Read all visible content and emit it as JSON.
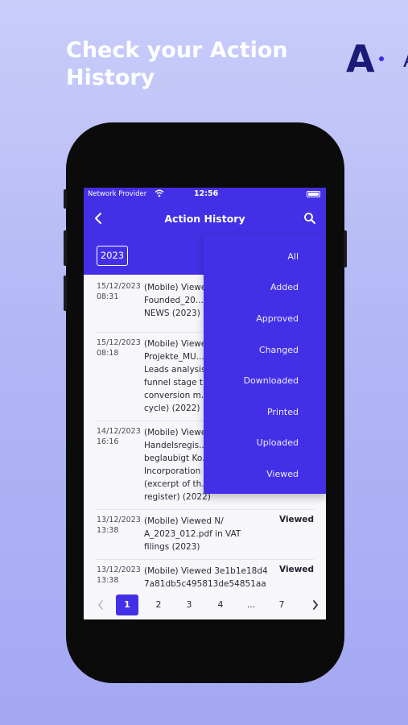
{
  "promo": {
    "headline_line1": "Check your Action",
    "headline_line2": "History",
    "logo_letter": "A",
    "logo_next": "A"
  },
  "status_bar": {
    "carrier": "Network Provider",
    "time": "12:56"
  },
  "header": {
    "title": "Action History",
    "year": "2023"
  },
  "filter_menu": {
    "options": [
      "All",
      "Added",
      "Approved",
      "Changed",
      "Downloaded",
      "Printed",
      "Uploaded",
      "Viewed"
    ]
  },
  "history": [
    {
      "date": "15/12/2023",
      "time": "08:31",
      "description": "(Mobile) Viewed\nFounded_20...\nNEWS (2023)",
      "action": ""
    },
    {
      "date": "15/12/2023",
      "time": "08:18",
      "description": "(Mobile) Viewed\nProjekte_MU...\nLeads analysis\nfunnel stage t...\nconversion m...\ncycle) (2022)",
      "action": ""
    },
    {
      "date": "14/12/2023",
      "time": "16:16",
      "description": "(Mobile) Viewed\nHandelsregis...\nbeglaubigt Ko...\nIncorporation\n(excerpt of th...\nregister) (2022)",
      "action": ""
    },
    {
      "date": "13/12/2023",
      "time": "13:38",
      "description": "(Mobile) Viewed N/\nA_2023_012.pdf in VAT\nfilings (2023)",
      "action": "Viewed"
    },
    {
      "date": "13/12/2023",
      "time": "13:38",
      "description": "(Mobile) Viewed 3e1b1e18d4\n7a81db5c495813de54851aa",
      "action": "Viewed"
    }
  ],
  "pagination": {
    "pages": [
      "1",
      "2",
      "3",
      "4",
      "...",
      "7"
    ],
    "current": "1"
  },
  "colors": {
    "primary": "#4330e6",
    "background_top": "#c9cdfa",
    "background_bottom": "#a4a8f3",
    "logo": "#1c1a78"
  }
}
